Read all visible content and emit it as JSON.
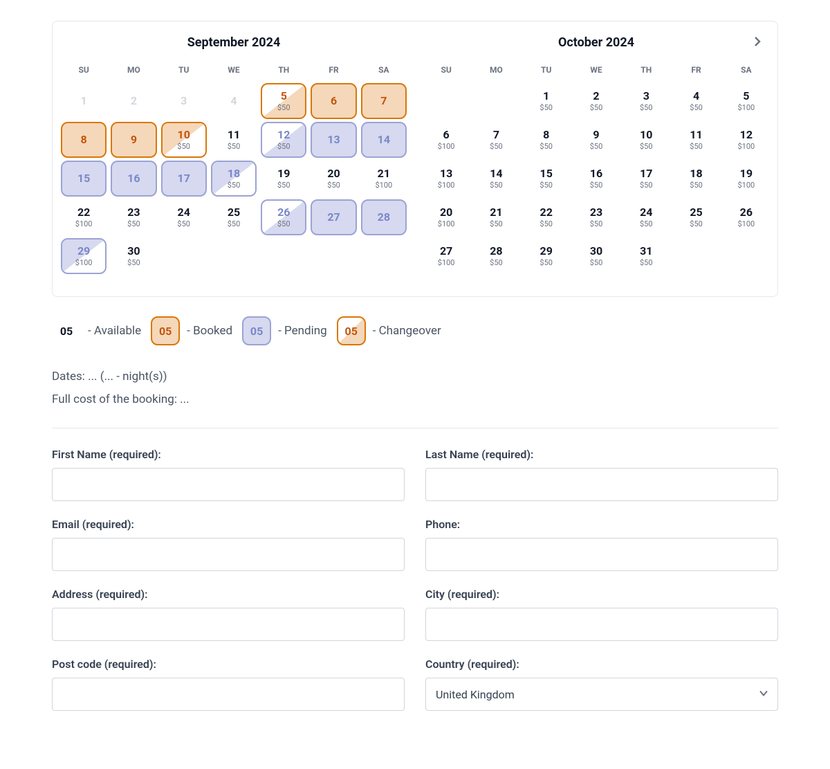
{
  "calendar": {
    "dow": [
      "SU",
      "MO",
      "TU",
      "WE",
      "TH",
      "FR",
      "SA"
    ],
    "months": [
      {
        "title": "September 2024",
        "weeks": [
          [
            {
              "n": "1",
              "status": "muted"
            },
            {
              "n": "2",
              "status": "muted"
            },
            {
              "n": "3",
              "status": "muted"
            },
            {
              "n": "4",
              "status": "muted"
            },
            {
              "n": "5",
              "price": "$50",
              "status": "changeover"
            },
            {
              "n": "6",
              "status": "booked"
            },
            {
              "n": "7",
              "status": "booked"
            }
          ],
          [
            {
              "n": "8",
              "status": "booked"
            },
            {
              "n": "9",
              "status": "booked"
            },
            {
              "n": "10",
              "price": "$50",
              "status": "changeover-out-booked"
            },
            {
              "n": "11",
              "price": "$50",
              "status": "avail"
            },
            {
              "n": "12",
              "price": "$50",
              "status": "changeover-pending"
            },
            {
              "n": "13",
              "status": "pending"
            },
            {
              "n": "14",
              "status": "pending"
            }
          ],
          [
            {
              "n": "15",
              "status": "pending"
            },
            {
              "n": "16",
              "status": "pending"
            },
            {
              "n": "17",
              "status": "pending"
            },
            {
              "n": "18",
              "price": "$50",
              "status": "changeover-out-pending"
            },
            {
              "n": "19",
              "price": "$50",
              "status": "avail"
            },
            {
              "n": "20",
              "price": "$50",
              "status": "avail"
            },
            {
              "n": "21",
              "price": "$100",
              "status": "avail"
            }
          ],
          [
            {
              "n": "22",
              "price": "$100",
              "status": "avail"
            },
            {
              "n": "23",
              "price": "$50",
              "status": "avail"
            },
            {
              "n": "24",
              "price": "$50",
              "status": "avail"
            },
            {
              "n": "25",
              "price": "$50",
              "status": "avail"
            },
            {
              "n": "26",
              "price": "$50",
              "status": "changeover-pending"
            },
            {
              "n": "27",
              "status": "pending"
            },
            {
              "n": "28",
              "status": "pending"
            }
          ],
          [
            {
              "n": "29",
              "price": "$100",
              "status": "changeover-out-pending"
            },
            {
              "n": "30",
              "price": "$50",
              "status": "avail"
            },
            {
              "empty": true
            },
            {
              "empty": true
            },
            {
              "empty": true
            },
            {
              "empty": true
            },
            {
              "empty": true
            }
          ]
        ]
      },
      {
        "title": "October 2024",
        "weeks": [
          [
            {
              "empty": true
            },
            {
              "empty": true
            },
            {
              "n": "1",
              "price": "$50",
              "status": "avail"
            },
            {
              "n": "2",
              "price": "$50",
              "status": "avail"
            },
            {
              "n": "3",
              "price": "$50",
              "status": "avail"
            },
            {
              "n": "4",
              "price": "$50",
              "status": "avail"
            },
            {
              "n": "5",
              "price": "$100",
              "status": "avail"
            }
          ],
          [
            {
              "n": "6",
              "price": "$100",
              "status": "avail"
            },
            {
              "n": "7",
              "price": "$50",
              "status": "avail"
            },
            {
              "n": "8",
              "price": "$50",
              "status": "avail"
            },
            {
              "n": "9",
              "price": "$50",
              "status": "avail"
            },
            {
              "n": "10",
              "price": "$50",
              "status": "avail"
            },
            {
              "n": "11",
              "price": "$50",
              "status": "avail"
            },
            {
              "n": "12",
              "price": "$100",
              "status": "avail"
            }
          ],
          [
            {
              "n": "13",
              "price": "$100",
              "status": "avail"
            },
            {
              "n": "14",
              "price": "$50",
              "status": "avail"
            },
            {
              "n": "15",
              "price": "$50",
              "status": "avail"
            },
            {
              "n": "16",
              "price": "$50",
              "status": "avail"
            },
            {
              "n": "17",
              "price": "$50",
              "status": "avail"
            },
            {
              "n": "18",
              "price": "$50",
              "status": "avail"
            },
            {
              "n": "19",
              "price": "$100",
              "status": "avail"
            }
          ],
          [
            {
              "n": "20",
              "price": "$100",
              "status": "avail"
            },
            {
              "n": "21",
              "price": "$50",
              "status": "avail"
            },
            {
              "n": "22",
              "price": "$50",
              "status": "avail"
            },
            {
              "n": "23",
              "price": "$50",
              "status": "avail"
            },
            {
              "n": "24",
              "price": "$50",
              "status": "avail"
            },
            {
              "n": "25",
              "price": "$50",
              "status": "avail"
            },
            {
              "n": "26",
              "price": "$100",
              "status": "avail"
            }
          ],
          [
            {
              "n": "27",
              "price": "$100",
              "status": "avail"
            },
            {
              "n": "28",
              "price": "$50",
              "status": "avail"
            },
            {
              "n": "29",
              "price": "$50",
              "status": "avail"
            },
            {
              "n": "30",
              "price": "$50",
              "status": "avail"
            },
            {
              "n": "31",
              "price": "$50",
              "status": "avail"
            },
            {
              "empty": true
            },
            {
              "empty": true
            }
          ]
        ]
      }
    ]
  },
  "legend": {
    "sample": "05",
    "items": [
      {
        "label": "- Available",
        "class": "sw-avail"
      },
      {
        "label": "- Booked",
        "class": "sw-booked"
      },
      {
        "label": "- Pending",
        "class": "sw-pending"
      },
      {
        "label": "- Changeover",
        "class": "sw-change"
      }
    ]
  },
  "summary": {
    "dates": "Dates: ... (... - night(s))",
    "cost": "Full cost of the booking: ..."
  },
  "form": {
    "first_name_label": "First Name (required):",
    "last_name_label": "Last Name (required):",
    "email_label": "Email (required):",
    "phone_label": "Phone:",
    "address_label": "Address (required):",
    "city_label": "City (required):",
    "postcode_label": "Post code (required):",
    "country_label": "Country (required):",
    "country_selected": "United Kingdom"
  }
}
